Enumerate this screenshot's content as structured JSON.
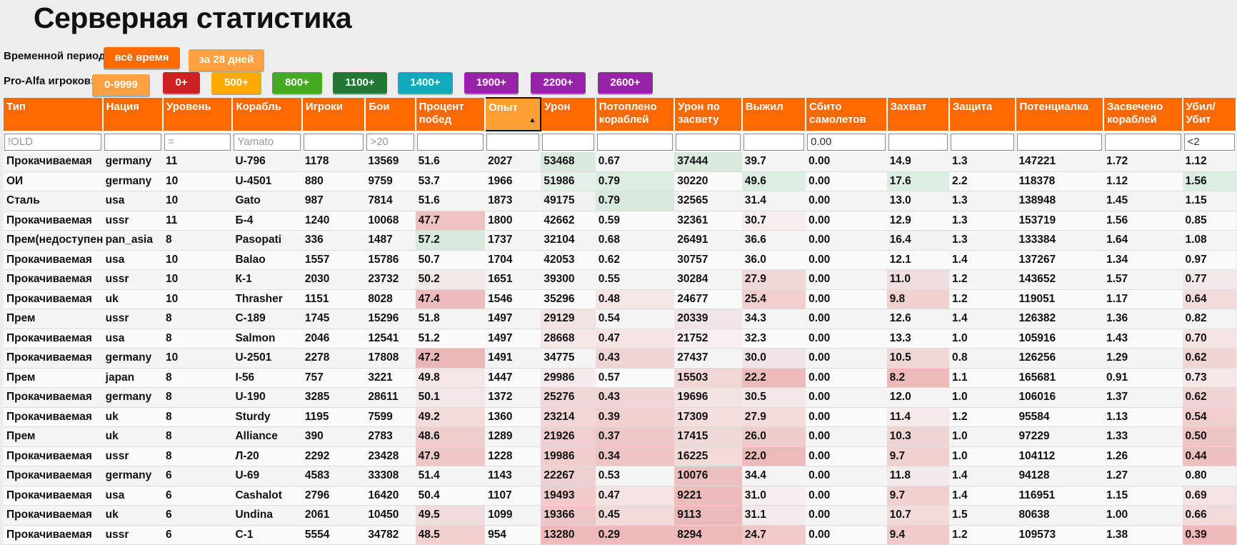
{
  "title": "Серверная статистика",
  "period": {
    "label": "Временной период:",
    "buttons": [
      {
        "label": "всё время",
        "color": "#ff6a00"
      },
      {
        "label": "за 28 дней",
        "color": "#ffa040"
      }
    ]
  },
  "pro_alfa": {
    "label": "Pro-Alfa игроков:",
    "buttons": [
      {
        "label": "0-9999",
        "color": "#ffa040"
      },
      {
        "label": "0+",
        "color": "#cc2222"
      },
      {
        "label": "500+",
        "color": "#ffaa00"
      },
      {
        "label": "800+",
        "color": "#44aa22"
      },
      {
        "label": "1100+",
        "color": "#227733"
      },
      {
        "label": "1400+",
        "color": "#11aabb"
      },
      {
        "label": "1900+",
        "color": "#9922aa"
      },
      {
        "label": "2200+",
        "color": "#9922aa"
      },
      {
        "label": "2600+",
        "color": "#9922aa"
      }
    ]
  },
  "table": {
    "headers": [
      "Тип",
      "Нация",
      "Уровень",
      "Корабль",
      "Игроки",
      "Бои",
      "Процент побед",
      "Опыт",
      "Урон",
      "Потоплено кораблей",
      "Урон по засвету",
      "Выжил",
      "Сбито самолетов",
      "Захват",
      "Защита",
      "Потенциалка",
      "Засвечено кораблей",
      "Убил/ Убит"
    ],
    "sorted_column": 7,
    "filters": [
      {
        "value": "",
        "placeholder": "!OLD"
      },
      {
        "value": "",
        "placeholder": ""
      },
      {
        "value": "",
        "placeholder": "="
      },
      {
        "value": "",
        "placeholder": "Yamato"
      },
      {
        "value": "",
        "placeholder": ""
      },
      {
        "value": "",
        "placeholder": ">20"
      },
      {
        "value": "",
        "placeholder": ""
      },
      {
        "value": "",
        "placeholder": ""
      },
      {
        "value": "",
        "placeholder": ""
      },
      {
        "value": "",
        "placeholder": ""
      },
      {
        "value": "",
        "placeholder": ""
      },
      {
        "value": "",
        "placeholder": ""
      },
      {
        "value": "0.00",
        "placeholder": ""
      },
      {
        "value": "",
        "placeholder": ""
      },
      {
        "value": "",
        "placeholder": ""
      },
      {
        "value": "",
        "placeholder": ""
      },
      {
        "value": "",
        "placeholder": ""
      },
      {
        "value": "<2",
        "placeholder": ""
      }
    ],
    "rows": [
      [
        "Прокачиваемая",
        "germany",
        "11",
        "U-796",
        "1178",
        "13569",
        "51.6",
        "2027",
        "53468",
        "0.67",
        "37444",
        "39.7",
        "0.00",
        "14.9",
        "1.3",
        "147221",
        "1.72",
        "1.12"
      ],
      [
        "ОИ",
        "germany",
        "10",
        "U-4501",
        "880",
        "9759",
        "53.7",
        "1966",
        "51986",
        "0.79",
        "30220",
        "49.6",
        "0.00",
        "17.6",
        "2.2",
        "118378",
        "1.12",
        "1.56"
      ],
      [
        "Сталь",
        "usa",
        "10",
        "Gato",
        "987",
        "7814",
        "51.6",
        "1873",
        "49175",
        "0.79",
        "32565",
        "31.4",
        "0.00",
        "13.0",
        "1.3",
        "138948",
        "1.45",
        "1.15"
      ],
      [
        "Прокачиваемая",
        "ussr",
        "11",
        "Б-4",
        "1240",
        "10068",
        "47.7",
        "1800",
        "42662",
        "0.59",
        "32361",
        "30.7",
        "0.00",
        "12.9",
        "1.3",
        "153719",
        "1.56",
        "0.85"
      ],
      [
        "Прем(недоступен)",
        "pan_asia",
        "8",
        "Pasopati",
        "336",
        "1487",
        "57.2",
        "1737",
        "32104",
        "0.68",
        "26491",
        "36.6",
        "0.00",
        "16.4",
        "1.3",
        "133384",
        "1.64",
        "1.08"
      ],
      [
        "Прокачиваемая",
        "usa",
        "10",
        "Balao",
        "1557",
        "15786",
        "50.7",
        "1704",
        "42053",
        "0.62",
        "30757",
        "36.0",
        "0.00",
        "12.1",
        "1.4",
        "137267",
        "1.34",
        "0.97"
      ],
      [
        "Прокачиваемая",
        "ussr",
        "10",
        "К-1",
        "2030",
        "23732",
        "50.2",
        "1651",
        "39300",
        "0.55",
        "30284",
        "27.9",
        "0.00",
        "11.0",
        "1.2",
        "143652",
        "1.57",
        "0.77"
      ],
      [
        "Прокачиваемая",
        "uk",
        "10",
        "Thrasher",
        "1151",
        "8028",
        "47.4",
        "1546",
        "35296",
        "0.48",
        "24677",
        "25.4",
        "0.00",
        "9.8",
        "1.2",
        "119051",
        "1.17",
        "0.64"
      ],
      [
        "Прем",
        "ussr",
        "8",
        "С-189",
        "1745",
        "15296",
        "51.8",
        "1497",
        "29129",
        "0.54",
        "20339",
        "34.3",
        "0.00",
        "12.6",
        "1.4",
        "126382",
        "1.36",
        "0.82"
      ],
      [
        "Прокачиваемая",
        "usa",
        "8",
        "Salmon",
        "2046",
        "12541",
        "51.2",
        "1497",
        "28668",
        "0.47",
        "21752",
        "32.3",
        "0.00",
        "13.3",
        "1.0",
        "105916",
        "1.43",
        "0.70"
      ],
      [
        "Прокачиваемая",
        "germany",
        "10",
        "U-2501",
        "2278",
        "17808",
        "47.2",
        "1491",
        "34775",
        "0.43",
        "27437",
        "30.0",
        "0.00",
        "10.5",
        "0.8",
        "126256",
        "1.29",
        "0.62"
      ],
      [
        "Прем",
        "japan",
        "8",
        "I-56",
        "757",
        "3221",
        "49.8",
        "1447",
        "29986",
        "0.57",
        "15503",
        "22.2",
        "0.00",
        "8.2",
        "1.1",
        "165681",
        "0.91",
        "0.73"
      ],
      [
        "Прокачиваемая",
        "germany",
        "8",
        "U-190",
        "3285",
        "28611",
        "50.1",
        "1372",
        "25276",
        "0.43",
        "19696",
        "30.5",
        "0.00",
        "12.0",
        "1.0",
        "106016",
        "1.37",
        "0.62"
      ],
      [
        "Прокачиваемая",
        "uk",
        "8",
        "Sturdy",
        "1195",
        "7599",
        "49.2",
        "1360",
        "23214",
        "0.39",
        "17309",
        "27.9",
        "0.00",
        "11.4",
        "1.2",
        "95584",
        "1.13",
        "0.54"
      ],
      [
        "Прем",
        "uk",
        "8",
        "Alliance",
        "390",
        "2783",
        "48.6",
        "1289",
        "21926",
        "0.37",
        "17415",
        "26.0",
        "0.00",
        "10.3",
        "1.0",
        "97229",
        "1.33",
        "0.50"
      ],
      [
        "Прокачиваемая",
        "ussr",
        "8",
        "Л-20",
        "2292",
        "23428",
        "47.9",
        "1228",
        "19986",
        "0.34",
        "16225",
        "22.0",
        "0.00",
        "9.7",
        "1.0",
        "104112",
        "1.26",
        "0.44"
      ],
      [
        "Прокачиваемая",
        "germany",
        "6",
        "U-69",
        "4583",
        "33308",
        "51.4",
        "1143",
        "22267",
        "0.53",
        "10076",
        "34.4",
        "0.00",
        "11.8",
        "1.4",
        "94128",
        "1.27",
        "0.80"
      ],
      [
        "Прокачиваемая",
        "usa",
        "6",
        "Cashalot",
        "2796",
        "16420",
        "50.4",
        "1107",
        "19493",
        "0.47",
        "9221",
        "31.0",
        "0.00",
        "9.7",
        "1.4",
        "116951",
        "1.15",
        "0.69"
      ],
      [
        "Прокачиваемая",
        "uk",
        "6",
        "Undina",
        "2061",
        "10450",
        "49.5",
        "1099",
        "19366",
        "0.45",
        "9113",
        "31.1",
        "0.00",
        "10.7",
        "1.5",
        "80638",
        "1.00",
        "0.66"
      ],
      [
        "Прокачиваемая",
        "ussr",
        "6",
        "С-1",
        "5554",
        "34782",
        "48.5",
        "954",
        "13280",
        "0.29",
        "8294",
        "24.7",
        "0.00",
        "9.4",
        "1.2",
        "109573",
        "1.38",
        "0.39"
      ]
    ]
  }
}
